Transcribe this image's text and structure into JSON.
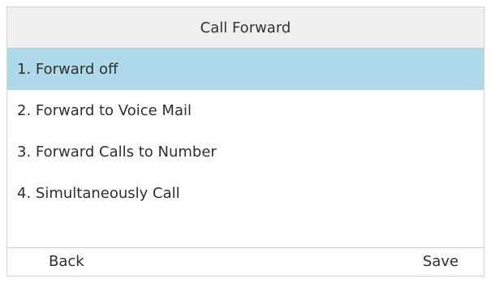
{
  "header": {
    "title": "Call Forward"
  },
  "menu": {
    "items": [
      {
        "label": "1. Forward off",
        "selected": true
      },
      {
        "label": "2. Forward to Voice Mail",
        "selected": false
      },
      {
        "label": "3. Forward Calls to Number",
        "selected": false
      },
      {
        "label": "4. Simultaneously Call",
        "selected": false
      }
    ]
  },
  "footer": {
    "back_label": "Back",
    "save_label": "Save"
  },
  "colors": {
    "selected_row": "#add9e9",
    "header_bg": "#efefef"
  }
}
